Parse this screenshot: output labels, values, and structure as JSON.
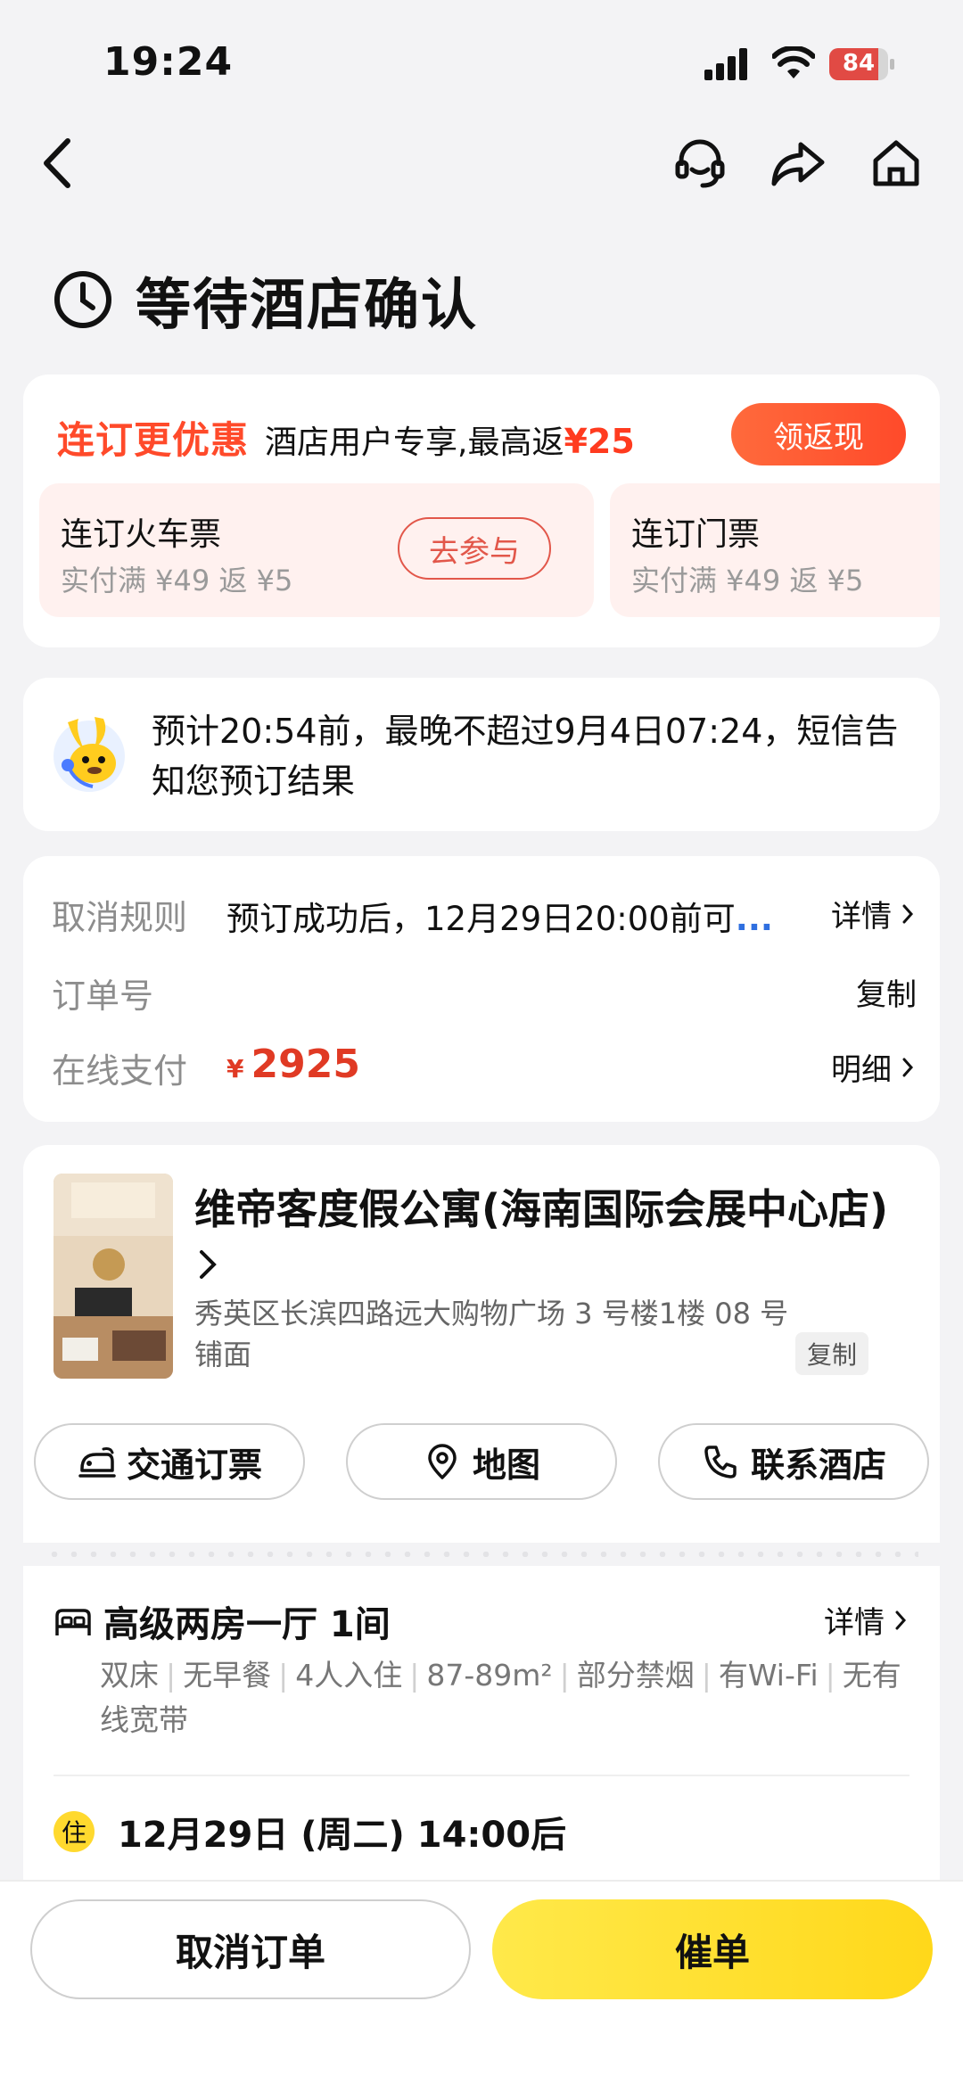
{
  "status_bar": {
    "time": "19:24",
    "battery": "84",
    "battery_level": 0.84
  },
  "nav": {
    "back": "back",
    "icons": [
      "headset-icon",
      "share-icon",
      "home-icon"
    ]
  },
  "order_status": {
    "title": "等待酒店确认"
  },
  "promo": {
    "title": "连订更优惠",
    "subtitle": "酒店用户专享,最高返",
    "amount": "¥25",
    "cashback_button": "领返现",
    "items": [
      {
        "title": "连订火车票",
        "desc": "实付满 ¥49 返 ¥5",
        "button": "去参与"
      },
      {
        "title": "连订门票",
        "desc": "实付满 ¥49 返 ¥5"
      }
    ]
  },
  "notice": {
    "text": "预计20:54前，最晚不超过9月4日07:24，短信告知您预订结果"
  },
  "order_info": {
    "cancel_rule_label": "取消规则",
    "cancel_rule_value": "预订成功后，12月29日20:00前可",
    "cancel_rule_ellipsis": "...",
    "cancel_rule_action": "详情",
    "order_no_label": "订单号",
    "order_no_action": "复制",
    "payment_label": "在线支付",
    "payment_currency": "¥",
    "payment_amount": "2925",
    "payment_action": "明细"
  },
  "hotel": {
    "name": "维帝客度假公寓(海南国际会展中心店)",
    "address": "秀英区长滨四路远大购物广场 3 号楼1楼 08 号铺面",
    "copy": "复制",
    "actions": {
      "transport": "交通订票",
      "map": "地图",
      "contact": "联系酒店"
    }
  },
  "room": {
    "title": "高级两房一厅 1间",
    "detail": "详情",
    "amenities": [
      "双床",
      "无早餐",
      "4人入住",
      "87-89m²",
      "部分禁烟",
      "有Wi-Fi",
      "无有线宽带"
    ]
  },
  "checkin": {
    "badge": "住",
    "text": "12月29日 (周二) 14:00后"
  },
  "bottom": {
    "cancel": "取消订单",
    "urge": "催单"
  },
  "colors": {
    "accent_red": "#ff4a2a",
    "price_red": "#e03a24",
    "yellow": "#ffd81a"
  }
}
